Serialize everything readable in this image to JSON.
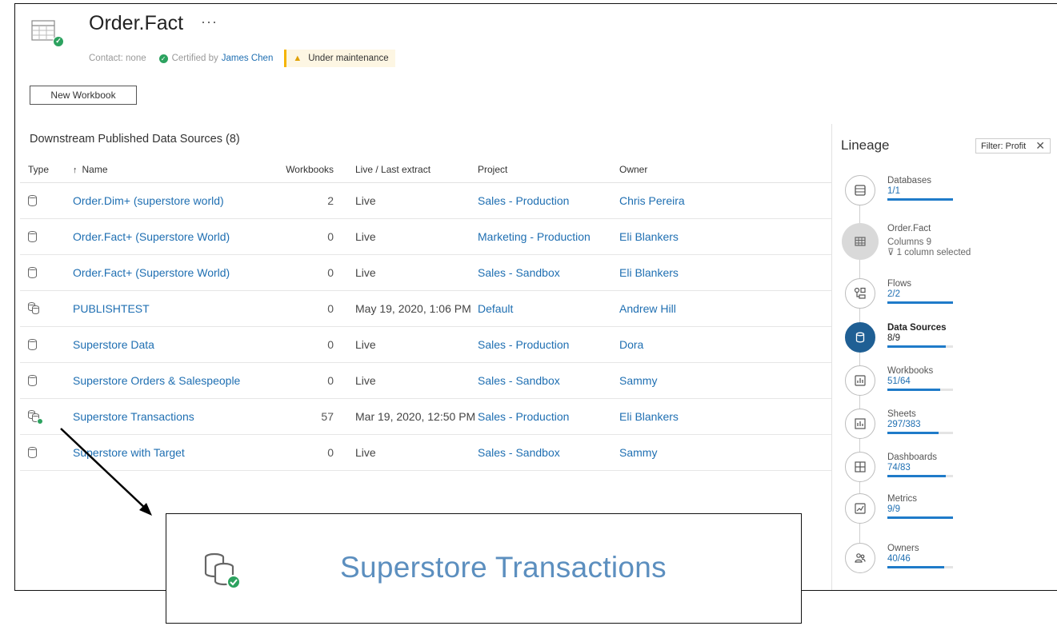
{
  "header": {
    "title": "Order.Fact",
    "more_label": "···",
    "contact": "Contact: none",
    "certified_by": "Certified by",
    "certifier": "James Chen",
    "warning": "Under maintenance",
    "new_workbook": "New Workbook"
  },
  "table": {
    "section_title": "Downstream Published Data Sources (8)",
    "columns": {
      "type": "Type",
      "name": "Name",
      "sort_arrow": "↑",
      "workbooks": "Workbooks",
      "live": "Live / Last extract",
      "project": "Project",
      "owner": "Owner"
    },
    "rows": [
      {
        "name": "Order.Dim+ (superstore world)",
        "workbooks": "2",
        "live": "Live",
        "project": "Sales - Production",
        "owner": "Chris Pereira",
        "icon": "database-icon"
      },
      {
        "name": "Order.Fact+ (Superstore World)",
        "workbooks": "0",
        "live": "Live",
        "project": "Marketing - Production",
        "owner": "Eli Blankers",
        "icon": "database-icon"
      },
      {
        "name": "Order.Fact+ (Superstore World)",
        "workbooks": "0",
        "live": "Live",
        "project": "Sales - Sandbox",
        "owner": "Eli Blankers",
        "icon": "database-icon"
      },
      {
        "name": "PUBLISHTEST",
        "workbooks": "0",
        "live": "May 19, 2020, 1:06 PM",
        "project": "Default",
        "owner": "Andrew Hill",
        "icon": "multi-database-icon"
      },
      {
        "name": "Superstore Data",
        "workbooks": "0",
        "live": "Live",
        "project": "Sales - Production",
        "owner": "Dora",
        "icon": "database-icon"
      },
      {
        "name": "Superstore Orders & Salespeople",
        "workbooks": "0",
        "live": "Live",
        "project": "Sales - Sandbox",
        "owner": "Sammy",
        "icon": "database-icon"
      },
      {
        "name": "Superstore Transactions",
        "workbooks": "57",
        "live": "Mar 19, 2020, 12:50 PM",
        "project": "Sales - Production",
        "owner": "Eli Blankers",
        "icon": "certified-multi-database-icon"
      },
      {
        "name": "Superstore with Target",
        "workbooks": "0",
        "live": "Live",
        "project": "Sales - Sandbox",
        "owner": "Sammy",
        "icon": "database-icon"
      }
    ]
  },
  "lineage": {
    "title": "Lineage",
    "filter": "Filter: Profit",
    "items": [
      {
        "name": "Databases",
        "count": "1/1",
        "fill": 1.0
      },
      {
        "name": "Order.Fact",
        "columns": "Columns 9",
        "selected": "1 column selected"
      },
      {
        "name": "Flows",
        "count": "2/2",
        "fill": 1.0
      },
      {
        "name": "Data Sources",
        "count": "8/9",
        "fill": 0.89
      },
      {
        "name": "Workbooks",
        "count": "51/64",
        "fill": 0.8
      },
      {
        "name": "Sheets",
        "count": "297/383",
        "fill": 0.78
      },
      {
        "name": "Dashboards",
        "count": "74/83",
        "fill": 0.89
      },
      {
        "name": "Metrics",
        "count": "9/9",
        "fill": 1.0
      },
      {
        "name": "Owners",
        "count": "40/46",
        "fill": 0.87
      }
    ]
  },
  "callout": {
    "label": "Superstore Transactions"
  },
  "colors": {
    "link": "#1f6fb2",
    "accent": "#1f5f94",
    "certified": "#2ca25f",
    "warning": "#f5b400"
  }
}
